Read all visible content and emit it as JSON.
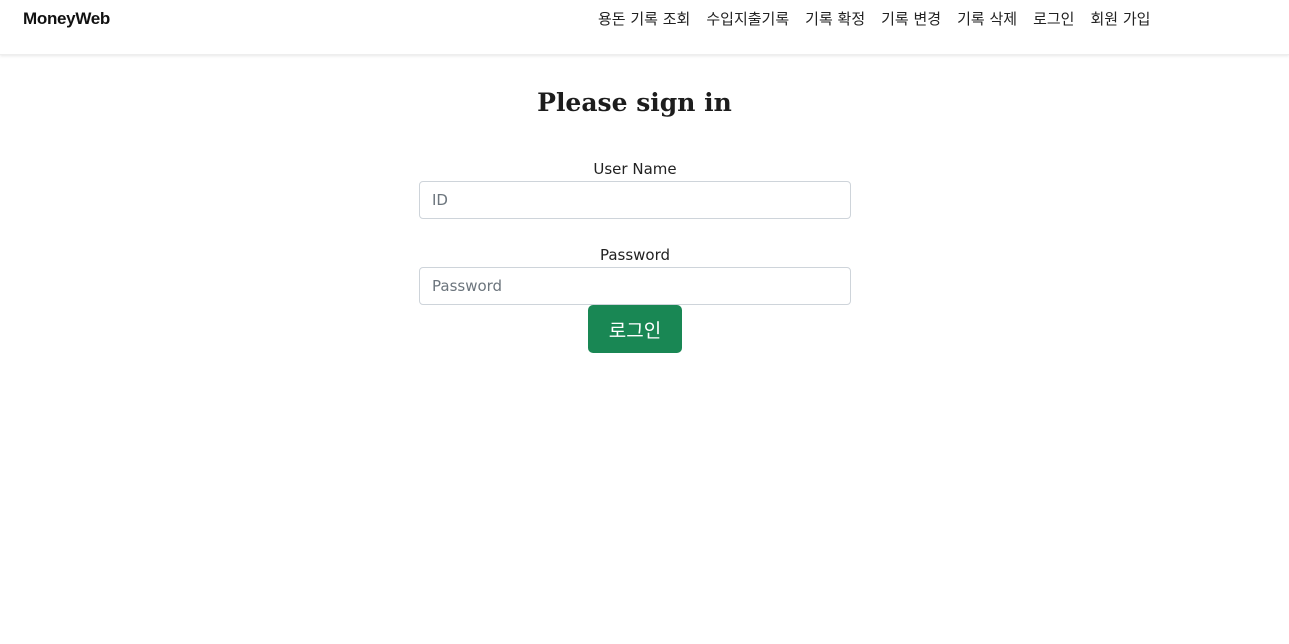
{
  "navbar": {
    "brand": "MoneyWeb",
    "links": [
      {
        "label": "용돈 기록 조회"
      },
      {
        "label": "수입지출기록"
      },
      {
        "label": "기록 확정"
      },
      {
        "label": "기록 변경"
      },
      {
        "label": "기록 삭제"
      },
      {
        "label": "로그인"
      },
      {
        "label": "회원 가입"
      }
    ]
  },
  "form": {
    "title": "Please sign in",
    "username": {
      "label": "User Name",
      "value": "",
      "placeholder": "ID"
    },
    "password": {
      "label": "Password",
      "value": "",
      "placeholder": "Password"
    },
    "submit_label": "로그인"
  },
  "colors": {
    "accent": "#198754",
    "text": "#212529",
    "input_border": "#ced4da",
    "placeholder": "#6c757d"
  }
}
